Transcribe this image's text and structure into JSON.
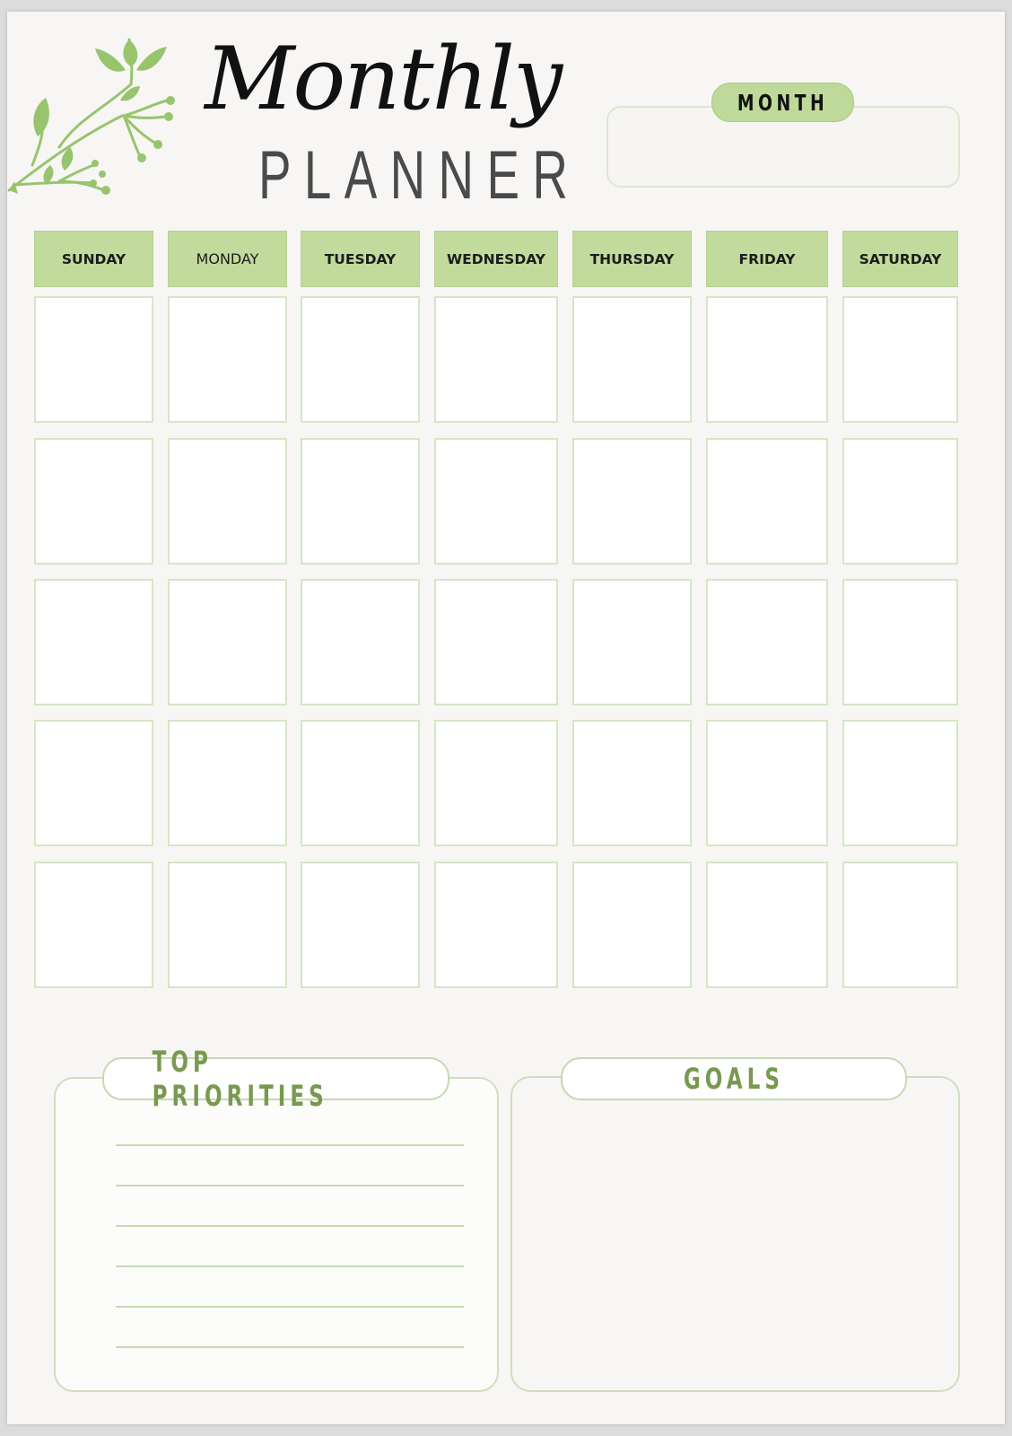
{
  "header": {
    "title_script": "Monthly",
    "title_main": "PLANNER",
    "month_label": "MONTH",
    "month_value": ""
  },
  "calendar": {
    "days": [
      {
        "label": "SUNDAY",
        "bold": true
      },
      {
        "label": "MONDAY",
        "bold": false
      },
      {
        "label": "TUESDAY",
        "bold": true
      },
      {
        "label": "WEDNESDAY",
        "bold": true
      },
      {
        "label": "THURSDAY",
        "bold": true
      },
      {
        "label": "FRIDAY",
        "bold": true
      },
      {
        "label": "SATURDAY",
        "bold": true
      }
    ],
    "weeks": 5,
    "cells": [
      [
        "",
        "",
        "",
        "",
        "",
        "",
        ""
      ],
      [
        "",
        "",
        "",
        "",
        "",
        "",
        ""
      ],
      [
        "",
        "",
        "",
        "",
        "",
        "",
        ""
      ],
      [
        "",
        "",
        "",
        "",
        "",
        "",
        ""
      ],
      [
        "",
        "",
        "",
        "",
        "",
        "",
        ""
      ]
    ]
  },
  "priorities": {
    "title": "TOP PRIORITIES",
    "lines": [
      "",
      "",
      "",
      "",
      "",
      ""
    ]
  },
  "goals": {
    "title": "GOALS",
    "content": ""
  },
  "colors": {
    "accent_green": "#c2da9c",
    "title_green": "#78994f",
    "border_green": "#d6e6c4",
    "paper": "#f7f6f4"
  }
}
